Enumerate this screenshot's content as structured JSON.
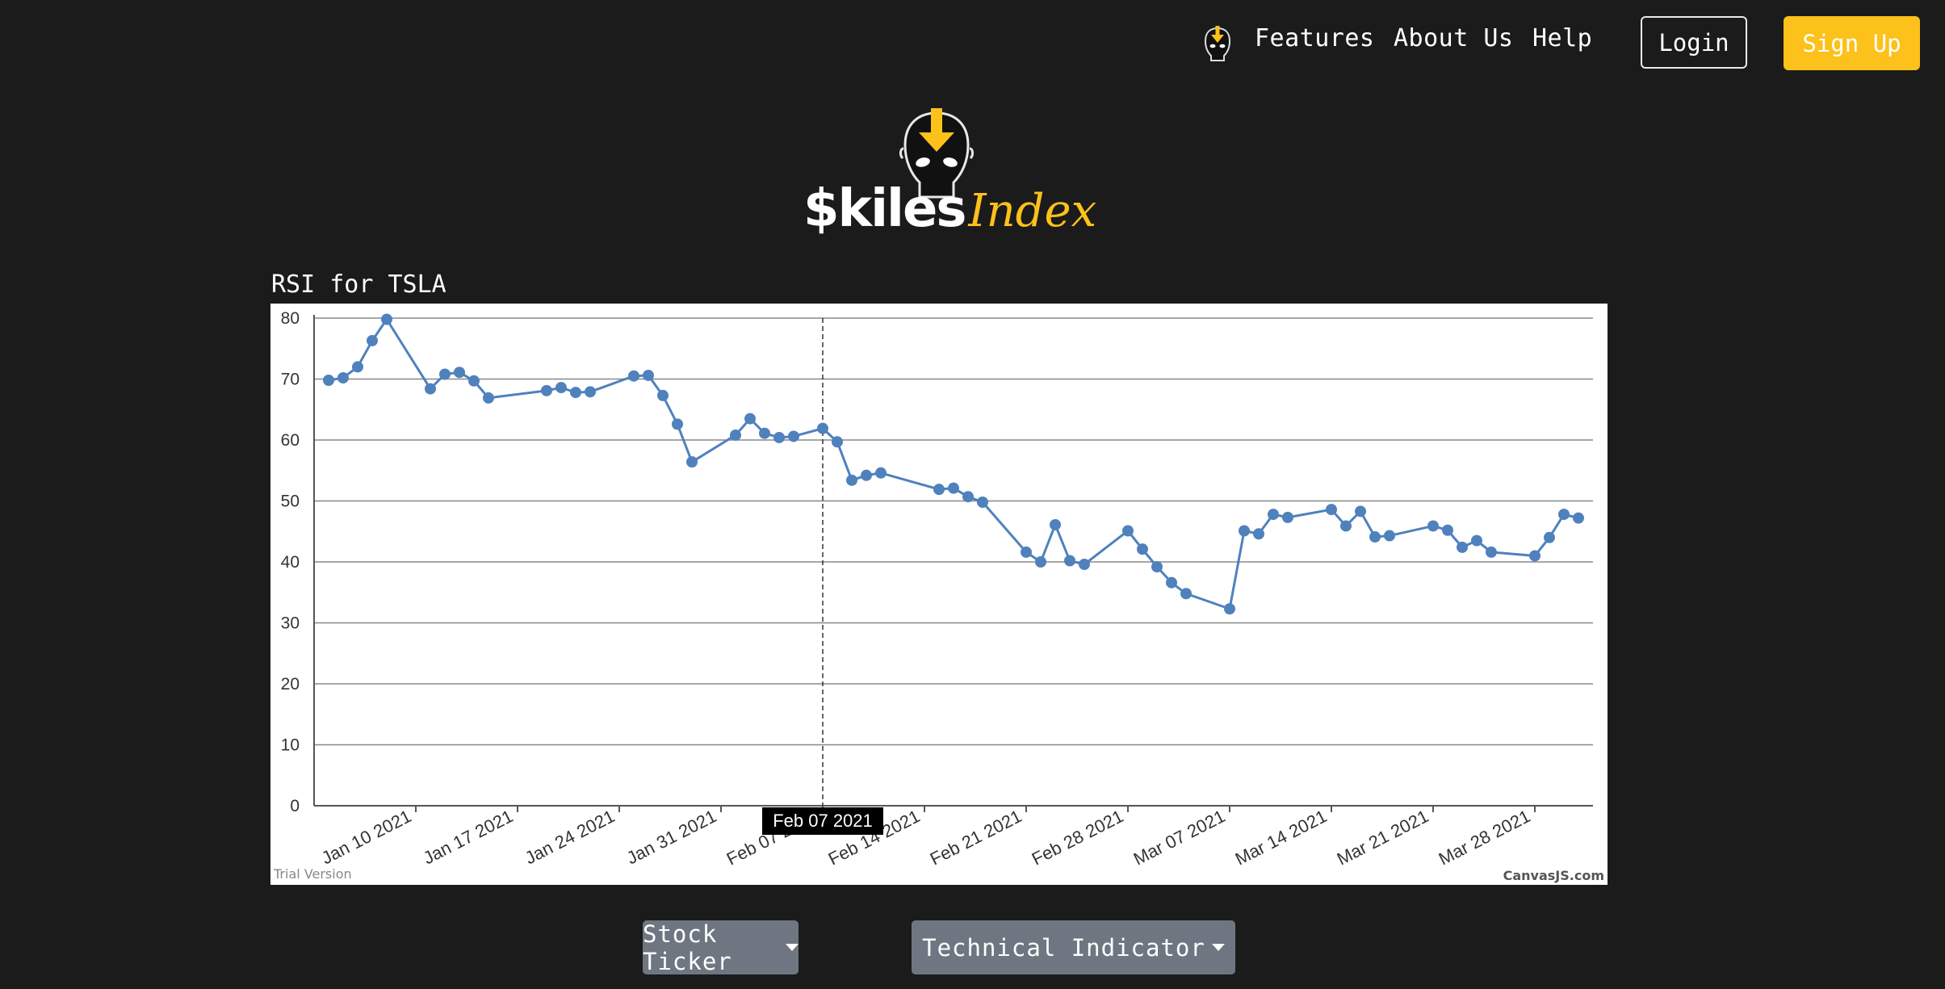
{
  "nav": {
    "links": [
      "Features",
      "About Us",
      "Help"
    ],
    "login_label": "Login",
    "signup_label": "Sign Up"
  },
  "logo": {
    "main": "$kiles",
    "sub": "Index"
  },
  "chart": {
    "title": "RSI for TSLA",
    "trial_label": "Trial Version",
    "credit_label": "CanvasJS.com",
    "tooltip_label": "Feb 07 2021"
  },
  "chart_data": {
    "type": "line",
    "ylim": [
      0,
      80
    ],
    "yticks": [
      0,
      10,
      20,
      30,
      40,
      50,
      60,
      70,
      80
    ],
    "xticks": [
      "Jan 10 2021",
      "Jan 17 2021",
      "Jan 24 2021",
      "Jan 31 2021",
      "Feb 07 2021",
      "Feb 14 2021",
      "Feb 21 2021",
      "Feb 28 2021",
      "Mar 07 2021",
      "Mar 14 2021",
      "Mar 21 2021",
      "Mar 28 2021"
    ],
    "grid": true,
    "series_color": "#4f81bd",
    "crosshair_x": "2021-02-07",
    "points": [
      {
        "x": "2021-01-04",
        "y": 69.8
      },
      {
        "x": "2021-01-05",
        "y": 70.2
      },
      {
        "x": "2021-01-06",
        "y": 72.0
      },
      {
        "x": "2021-01-07",
        "y": 76.3
      },
      {
        "x": "2021-01-08",
        "y": 79.8
      },
      {
        "x": "2021-01-11",
        "y": 68.4
      },
      {
        "x": "2021-01-12",
        "y": 70.8
      },
      {
        "x": "2021-01-13",
        "y": 71.1
      },
      {
        "x": "2021-01-14",
        "y": 69.7
      },
      {
        "x": "2021-01-15",
        "y": 66.9
      },
      {
        "x": "2021-01-19",
        "y": 68.1
      },
      {
        "x": "2021-01-20",
        "y": 68.6
      },
      {
        "x": "2021-01-21",
        "y": 67.8
      },
      {
        "x": "2021-01-22",
        "y": 67.9
      },
      {
        "x": "2021-01-25",
        "y": 70.5
      },
      {
        "x": "2021-01-26",
        "y": 70.6
      },
      {
        "x": "2021-01-27",
        "y": 67.3
      },
      {
        "x": "2021-01-28",
        "y": 62.6
      },
      {
        "x": "2021-01-29",
        "y": 56.4
      },
      {
        "x": "2021-02-01",
        "y": 60.8
      },
      {
        "x": "2021-02-02",
        "y": 63.5
      },
      {
        "x": "2021-02-03",
        "y": 61.1
      },
      {
        "x": "2021-02-04",
        "y": 60.4
      },
      {
        "x": "2021-02-05",
        "y": 60.6
      },
      {
        "x": "2021-02-07",
        "y": 61.9
      },
      {
        "x": "2021-02-08",
        "y": 59.7
      },
      {
        "x": "2021-02-09",
        "y": 53.4
      },
      {
        "x": "2021-02-10",
        "y": 54.2
      },
      {
        "x": "2021-02-11",
        "y": 54.6
      },
      {
        "x": "2021-02-15",
        "y": 51.9
      },
      {
        "x": "2021-02-16",
        "y": 52.1
      },
      {
        "x": "2021-02-17",
        "y": 50.7
      },
      {
        "x": "2021-02-18",
        "y": 49.8
      },
      {
        "x": "2021-02-21",
        "y": 41.6
      },
      {
        "x": "2021-02-22",
        "y": 40.0
      },
      {
        "x": "2021-02-23",
        "y": 46.1
      },
      {
        "x": "2021-02-24",
        "y": 40.2
      },
      {
        "x": "2021-02-25",
        "y": 39.6
      },
      {
        "x": "2021-02-28",
        "y": 45.1
      },
      {
        "x": "2021-03-01",
        "y": 42.1
      },
      {
        "x": "2021-03-02",
        "y": 39.2
      },
      {
        "x": "2021-03-03",
        "y": 36.6
      },
      {
        "x": "2021-03-04",
        "y": 34.8
      },
      {
        "x": "2021-03-07",
        "y": 32.3
      },
      {
        "x": "2021-03-08",
        "y": 45.1
      },
      {
        "x": "2021-03-09",
        "y": 44.6
      },
      {
        "x": "2021-03-10",
        "y": 47.8
      },
      {
        "x": "2021-03-11",
        "y": 47.3
      },
      {
        "x": "2021-03-14",
        "y": 48.6
      },
      {
        "x": "2021-03-15",
        "y": 45.9
      },
      {
        "x": "2021-03-16",
        "y": 48.3
      },
      {
        "x": "2021-03-17",
        "y": 44.1
      },
      {
        "x": "2021-03-18",
        "y": 44.3
      },
      {
        "x": "2021-03-21",
        "y": 45.9
      },
      {
        "x": "2021-03-22",
        "y": 45.2
      },
      {
        "x": "2021-03-23",
        "y": 42.4
      },
      {
        "x": "2021-03-24",
        "y": 43.5
      },
      {
        "x": "2021-03-25",
        "y": 41.6
      },
      {
        "x": "2021-03-28",
        "y": 41.0
      },
      {
        "x": "2021-03-29",
        "y": 44.0
      },
      {
        "x": "2021-03-30",
        "y": 47.8
      },
      {
        "x": "2021-03-31",
        "y": 47.2
      }
    ]
  },
  "controls": {
    "stock_ticker_label": "Stock Ticker",
    "technical_indicator_label": "Technical Indicator"
  },
  "colors": {
    "background": "#1b1b1b",
    "accent": "#fcc11a",
    "dropdown": "#6e7781",
    "line": "#4f81bd"
  },
  "icons": [
    "avatar-logo-icon",
    "caret-down-icon"
  ]
}
